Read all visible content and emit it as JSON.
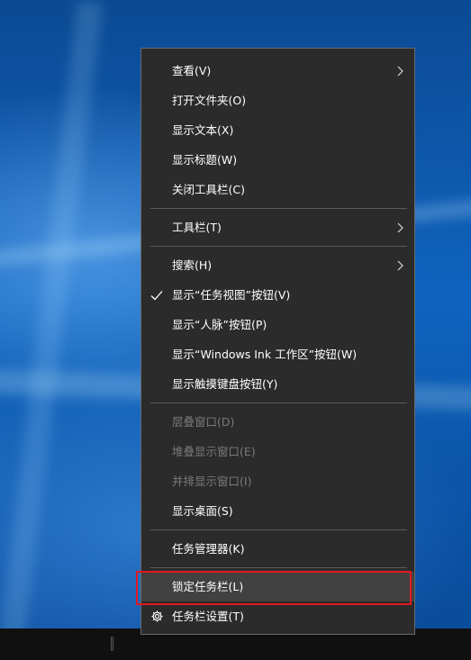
{
  "context_menu": {
    "items": [
      {
        "label": "查看(V)"
      },
      {
        "label": "打开文件夹(O)"
      },
      {
        "label": "显示文本(X)"
      },
      {
        "label": "显示标题(W)"
      },
      {
        "label": "关闭工具栏(C)"
      },
      {
        "label": "工具栏(T)"
      },
      {
        "label": "搜索(H)"
      },
      {
        "label": "显示“任务视图”按钮(V)"
      },
      {
        "label": "显示“人脉”按钮(P)"
      },
      {
        "label": "显示“Windows Ink 工作区”按钮(W)"
      },
      {
        "label": "显示触摸键盘按钮(Y)"
      },
      {
        "label": "层叠窗口(D)"
      },
      {
        "label": "堆叠显示窗口(E)"
      },
      {
        "label": "并排显示窗口(I)"
      },
      {
        "label": "显示桌面(S)"
      },
      {
        "label": "任务管理器(K)"
      },
      {
        "label": "锁定任务栏(L)"
      },
      {
        "label": "任务栏设置(T)"
      }
    ]
  },
  "colors": {
    "menu_background": "#2b2b2b",
    "menu_text": "#ffffff",
    "disabled_text": "#7a7a7a",
    "hover_background": "#414141",
    "annotation_red": "#e0191f",
    "taskbar": "#101010"
  },
  "icons": {
    "submenu": "chevron-right-icon",
    "checked": "check-icon",
    "settings": "gear-icon"
  }
}
